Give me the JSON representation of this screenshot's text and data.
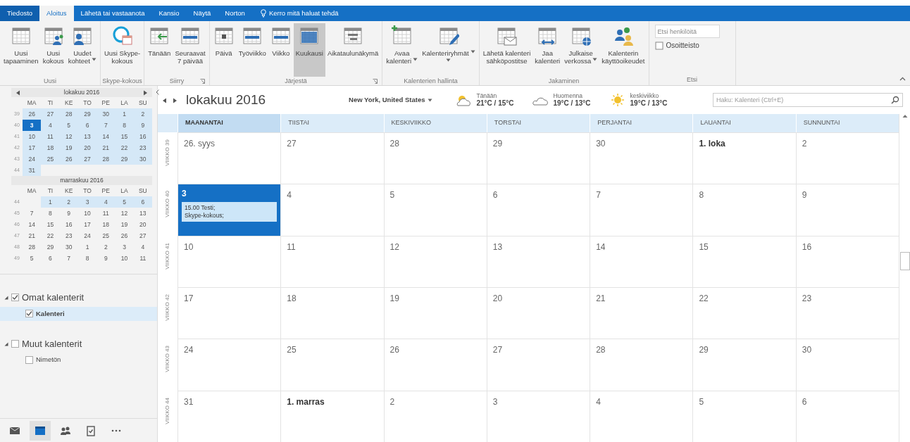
{
  "tabs": [
    {
      "label": "Tiedosto",
      "selected": false
    },
    {
      "label": "Aloitus",
      "selected": true
    },
    {
      "label": "Lähetä tai vastaanota",
      "selected": false
    },
    {
      "label": "Kansio",
      "selected": false
    },
    {
      "label": "Näytä",
      "selected": false
    },
    {
      "label": "Norton",
      "selected": false
    }
  ],
  "tell_me": {
    "placeholder": "Kerro mitä haluat tehdä"
  },
  "ribbon": {
    "groups": [
      {
        "label": "Uusi",
        "kind": "buttons",
        "launcher": false,
        "buttons": [
          {
            "kind": "plain",
            "lines": [
              "Uusi",
              "tapaaminen"
            ],
            "dropdown": false,
            "selected": false
          },
          {
            "kind": "people",
            "lines": [
              "Uusi",
              "kokous"
            ],
            "dropdown": false,
            "selected": false
          },
          {
            "kind": "items",
            "lines": [
              "Uudet",
              "kohteet"
            ],
            "dropdown": true,
            "selected": false
          }
        ]
      },
      {
        "label": "Skype-kokous",
        "kind": "buttons",
        "launcher": false,
        "buttons": [
          {
            "kind": "skype",
            "lines": [
              "Uusi Skype-",
              "kokous"
            ],
            "dropdown": false,
            "selected": false
          }
        ]
      },
      {
        "label": "Siirry",
        "kind": "buttons",
        "launcher": true,
        "buttons": [
          {
            "kind": "arrow",
            "lines": [
              "Tänään"
            ],
            "dropdown": false,
            "selected": false
          },
          {
            "kind": "strip",
            "lines": [
              "Seuraavat",
              "7 päivää"
            ],
            "dropdown": false,
            "selected": false
          }
        ]
      },
      {
        "label": "Järjestä",
        "kind": "buttons",
        "launcher": true,
        "buttons": [
          {
            "kind": "day",
            "lines": [
              "Päivä"
            ],
            "dropdown": false,
            "selected": false
          },
          {
            "kind": "strip",
            "lines": [
              "Työviikko"
            ],
            "dropdown": false,
            "selected": false
          },
          {
            "kind": "strip",
            "lines": [
              "Viikko"
            ],
            "dropdown": false,
            "selected": false
          },
          {
            "kind": "month",
            "lines": [
              "Kuukausi"
            ],
            "dropdown": false,
            "selected": true
          },
          {
            "kind": "schedule",
            "lines": [
              "Aikataulunäkymä"
            ],
            "dropdown": false,
            "selected": false
          }
        ]
      },
      {
        "label": "Kalenterien hallinta",
        "kind": "buttons",
        "launcher": false,
        "buttons": [
          {
            "kind": "plus",
            "lines": [
              "Avaa",
              "kalenteri"
            ],
            "dropdown": true,
            "selected": false
          },
          {
            "kind": "pen",
            "lines": [
              "Kalenteriryhmät"
            ],
            "dropdown": true,
            "selected": false
          }
        ]
      },
      {
        "label": "Jakaminen",
        "kind": "buttons",
        "launcher": false,
        "buttons": [
          {
            "kind": "mail",
            "lines": [
              "Lähetä kalenteri",
              "sähköpostitse"
            ],
            "dropdown": false,
            "selected": false
          },
          {
            "kind": "share",
            "lines": [
              "Jaa",
              "kalenteri"
            ],
            "dropdown": false,
            "selected": false
          },
          {
            "kind": "globe",
            "lines": [
              "Julkaise",
              "verkossa"
            ],
            "dropdown": true,
            "selected": false
          },
          {
            "kind": "team",
            "lines": [
              "Kalenterin",
              "käyttöoikeudet"
            ],
            "dropdown": false,
            "selected": false
          }
        ]
      },
      {
        "label": "Etsi",
        "kind": "search",
        "launcher": false,
        "field": {
          "placeholder": "Etsi henkilöitä"
        },
        "link": "Osoitteisto"
      }
    ]
  },
  "mini_calendars": [
    {
      "title": "lokakuu 2016",
      "nav": true,
      "weekdays": [
        "MA",
        "TI",
        "KE",
        "TO",
        "PE",
        "LA",
        "SU"
      ],
      "weeks": [
        {
          "week": "39",
          "days": [
            {
              "label": "26",
              "in_view": true,
              "selected": false
            },
            {
              "label": "27",
              "in_view": true,
              "selected": false
            },
            {
              "label": "28",
              "in_view": true,
              "selected": false
            },
            {
              "label": "29",
              "in_view": true,
              "selected": false
            },
            {
              "label": "30",
              "in_view": true,
              "selected": false
            },
            {
              "label": "1",
              "in_view": true,
              "selected": false
            },
            {
              "label": "2",
              "in_view": true,
              "selected": false
            }
          ]
        },
        {
          "week": "40",
          "days": [
            {
              "label": "3",
              "in_view": true,
              "selected": true
            },
            {
              "label": "4",
              "in_view": true,
              "selected": false
            },
            {
              "label": "5",
              "in_view": true,
              "selected": false
            },
            {
              "label": "6",
              "in_view": true,
              "selected": false
            },
            {
              "label": "7",
              "in_view": true,
              "selected": false
            },
            {
              "label": "8",
              "in_view": true,
              "selected": false
            },
            {
              "label": "9",
              "in_view": true,
              "selected": false
            }
          ]
        },
        {
          "week": "41",
          "days": [
            {
              "label": "10",
              "in_view": true,
              "selected": false
            },
            {
              "label": "11",
              "in_view": true,
              "selected": false
            },
            {
              "label": "12",
              "in_view": true,
              "selected": false
            },
            {
              "label": "13",
              "in_view": true,
              "selected": false
            },
            {
              "label": "14",
              "in_view": true,
              "selected": false
            },
            {
              "label": "15",
              "in_view": true,
              "selected": false
            },
            {
              "label": "16",
              "in_view": true,
              "selected": false
            }
          ]
        },
        {
          "week": "42",
          "days": [
            {
              "label": "17",
              "in_view": true,
              "selected": false
            },
            {
              "label": "18",
              "in_view": true,
              "selected": false
            },
            {
              "label": "19",
              "in_view": true,
              "selected": false
            },
            {
              "label": "20",
              "in_view": true,
              "selected": false
            },
            {
              "label": "21",
              "in_view": true,
              "selected": false
            },
            {
              "label": "22",
              "in_view": true,
              "selected": false
            },
            {
              "label": "23",
              "in_view": true,
              "selected": false
            }
          ]
        },
        {
          "week": "43",
          "days": [
            {
              "label": "24",
              "in_view": true,
              "selected": false
            },
            {
              "label": "25",
              "in_view": true,
              "selected": false
            },
            {
              "label": "26",
              "in_view": true,
              "selected": false
            },
            {
              "label": "27",
              "in_view": true,
              "selected": false
            },
            {
              "label": "28",
              "in_view": true,
              "selected": false
            },
            {
              "label": "29",
              "in_view": true,
              "selected": false
            },
            {
              "label": "30",
              "in_view": true,
              "selected": false
            }
          ]
        },
        {
          "week": "44",
          "days": [
            {
              "label": "31",
              "in_view": true,
              "selected": false
            }
          ]
        }
      ]
    },
    {
      "title": "marraskuu 2016",
      "nav": false,
      "weekdays": [
        "MA",
        "TI",
        "KE",
        "TO",
        "PE",
        "LA",
        "SU"
      ],
      "weeks": [
        {
          "week": "44",
          "days": [
            {
              "label": "1",
              "in_view": true,
              "selected": false
            },
            {
              "label": "2",
              "in_view": true,
              "selected": false
            },
            {
              "label": "3",
              "in_view": true,
              "selected": false
            },
            {
              "label": "4",
              "in_view": true,
              "selected": false
            },
            {
              "label": "5",
              "in_view": true,
              "selected": false
            },
            {
              "label": "6",
              "in_view": true,
              "selected": false
            }
          ]
        },
        {
          "week": "45",
          "days": [
            {
              "label": "7",
              "in_view": false,
              "selected": false
            },
            {
              "label": "8",
              "in_view": false,
              "selected": false
            },
            {
              "label": "9",
              "in_view": false,
              "selected": false
            },
            {
              "label": "10",
              "in_view": false,
              "selected": false
            },
            {
              "label": "11",
              "in_view": false,
              "selected": false
            },
            {
              "label": "12",
              "in_view": false,
              "selected": false
            },
            {
              "label": "13",
              "in_view": false,
              "selected": false
            }
          ]
        },
        {
          "week": "46",
          "days": [
            {
              "label": "14",
              "in_view": false,
              "selected": false
            },
            {
              "label": "15",
              "in_view": false,
              "selected": false
            },
            {
              "label": "16",
              "in_view": false,
              "selected": false
            },
            {
              "label": "17",
              "in_view": false,
              "selected": false
            },
            {
              "label": "18",
              "in_view": false,
              "selected": false
            },
            {
              "label": "19",
              "in_view": false,
              "selected": false
            },
            {
              "label": "20",
              "in_view": false,
              "selected": false
            }
          ]
        },
        {
          "week": "47",
          "days": [
            {
              "label": "21",
              "in_view": false,
              "selected": false
            },
            {
              "label": "22",
              "in_view": false,
              "selected": false
            },
            {
              "label": "23",
              "in_view": false,
              "selected": false
            },
            {
              "label": "24",
              "in_view": false,
              "selected": false
            },
            {
              "label": "25",
              "in_view": false,
              "selected": false
            },
            {
              "label": "26",
              "in_view": false,
              "selected": false
            },
            {
              "label": "27",
              "in_view": false,
              "selected": false
            }
          ]
        },
        {
          "week": "48",
          "days": [
            {
              "label": "28",
              "in_view": false,
              "selected": false
            },
            {
              "label": "29",
              "in_view": false,
              "selected": false
            },
            {
              "label": "30",
              "in_view": false,
              "selected": false
            },
            {
              "label": "1",
              "in_view": false,
              "selected": false
            },
            {
              "label": "2",
              "in_view": false,
              "selected": false
            },
            {
              "label": "3",
              "in_view": false,
              "selected": false
            },
            {
              "label": "4",
              "in_view": false,
              "selected": false
            }
          ]
        },
        {
          "week": "49",
          "days": [
            {
              "label": "5",
              "in_view": false,
              "selected": false
            },
            {
              "label": "6",
              "in_view": false,
              "selected": false
            },
            {
              "label": "7",
              "in_view": false,
              "selected": false
            },
            {
              "label": "8",
              "in_view": false,
              "selected": false
            },
            {
              "label": "9",
              "in_view": false,
              "selected": false
            },
            {
              "label": "10",
              "in_view": false,
              "selected": false
            },
            {
              "label": "11",
              "in_view": false,
              "selected": false
            }
          ]
        }
      ]
    }
  ],
  "folders": [
    {
      "label": "Omat kalenterit",
      "checked": true,
      "expanded": true,
      "children": [
        {
          "label": "Kalenteri",
          "checked": true,
          "selected": true
        }
      ]
    },
    {
      "label": "Muut kalenterit",
      "checked": false,
      "expanded": true,
      "children": [
        {
          "label": "Nimetön",
          "checked": false,
          "selected": false
        }
      ]
    }
  ],
  "nav_bar": [
    {
      "kind": "mail",
      "selected": false
    },
    {
      "kind": "calendar",
      "selected": true
    },
    {
      "kind": "people",
      "selected": false
    },
    {
      "kind": "tasks",
      "selected": false
    },
    {
      "kind": "more",
      "selected": false
    }
  ],
  "calendar": {
    "title": "lokakuu 2016",
    "location": "New York, United States",
    "weather": [
      {
        "kind": "partly-sunny",
        "day": "Tänään",
        "temps": "21°C / 15°C"
      },
      {
        "kind": "cloudy",
        "day": "Huomenna",
        "temps": "19°C / 13°C"
      },
      {
        "kind": "sunny",
        "day": "keskiviikko",
        "temps": "19°C / 13°C"
      }
    ],
    "search": {
      "placeholder": "Haku: Kalenteri (Ctrl+E)"
    },
    "weekdays": [
      {
        "label": "MAANANTAI",
        "selected": true
      },
      {
        "label": "TIISTAI",
        "selected": false
      },
      {
        "label": "KESKIVIIKKO",
        "selected": false
      },
      {
        "label": "TORSTAI",
        "selected": false
      },
      {
        "label": "PERJANTAI",
        "selected": false
      },
      {
        "label": "LAUANTAI",
        "selected": false
      },
      {
        "label": "SUNNUNTAI",
        "selected": false
      }
    ],
    "weeks": [
      {
        "label": "VIIKKO 39",
        "days": [
          {
            "label": "26. syys",
            "bold": false,
            "selected": false
          },
          {
            "label": "27",
            "bold": false,
            "selected": false
          },
          {
            "label": "28",
            "bold": false,
            "selected": false
          },
          {
            "label": "29",
            "bold": false,
            "selected": false
          },
          {
            "label": "30",
            "bold": false,
            "selected": false
          },
          {
            "label": "1. loka",
            "bold": true,
            "selected": false
          },
          {
            "label": "2",
            "bold": false,
            "selected": false
          }
        ]
      },
      {
        "label": "VIIKKO 40",
        "days": [
          {
            "label": "3",
            "bold": true,
            "selected": true,
            "events": [
              {
                "lines": [
                  "15.00 Testi;",
                  "Skype-kokous;"
                ]
              }
            ]
          },
          {
            "label": "4",
            "bold": false,
            "selected": false
          },
          {
            "label": "5",
            "bold": false,
            "selected": false
          },
          {
            "label": "6",
            "bold": false,
            "selected": false
          },
          {
            "label": "7",
            "bold": false,
            "selected": false
          },
          {
            "label": "8",
            "bold": false,
            "selected": false
          },
          {
            "label": "9",
            "bold": false,
            "selected": false
          }
        ]
      },
      {
        "label": "VIIKKO 41",
        "days": [
          {
            "label": "10",
            "bold": false,
            "selected": false
          },
          {
            "label": "11",
            "bold": false,
            "selected": false
          },
          {
            "label": "12",
            "bold": false,
            "selected": false
          },
          {
            "label": "13",
            "bold": false,
            "selected": false
          },
          {
            "label": "14",
            "bold": false,
            "selected": false
          },
          {
            "label": "15",
            "bold": false,
            "selected": false
          },
          {
            "label": "16",
            "bold": false,
            "selected": false
          }
        ]
      },
      {
        "label": "VIIKKO 42",
        "days": [
          {
            "label": "17",
            "bold": false,
            "selected": false
          },
          {
            "label": "18",
            "bold": false,
            "selected": false
          },
          {
            "label": "19",
            "bold": false,
            "selected": false
          },
          {
            "label": "20",
            "bold": false,
            "selected": false
          },
          {
            "label": "21",
            "bold": false,
            "selected": false
          },
          {
            "label": "22",
            "bold": false,
            "selected": false
          },
          {
            "label": "23",
            "bold": false,
            "selected": false
          }
        ]
      },
      {
        "label": "VIIKKO 43",
        "days": [
          {
            "label": "24",
            "bold": false,
            "selected": false
          },
          {
            "label": "25",
            "bold": false,
            "selected": false
          },
          {
            "label": "26",
            "bold": false,
            "selected": false
          },
          {
            "label": "27",
            "bold": false,
            "selected": false
          },
          {
            "label": "28",
            "bold": false,
            "selected": false
          },
          {
            "label": "29",
            "bold": false,
            "selected": false
          },
          {
            "label": "30",
            "bold": false,
            "selected": false
          }
        ]
      },
      {
        "label": "VIIKKO 44",
        "days": [
          {
            "label": "31",
            "bold": false,
            "selected": false
          },
          {
            "label": "1. marras",
            "bold": true,
            "selected": false
          },
          {
            "label": "2",
            "bold": false,
            "selected": false
          },
          {
            "label": "3",
            "bold": false,
            "selected": false
          },
          {
            "label": "4",
            "bold": false,
            "selected": false
          },
          {
            "label": "5",
            "bold": false,
            "selected": false
          },
          {
            "label": "6",
            "bold": false,
            "selected": false
          }
        ]
      }
    ]
  }
}
